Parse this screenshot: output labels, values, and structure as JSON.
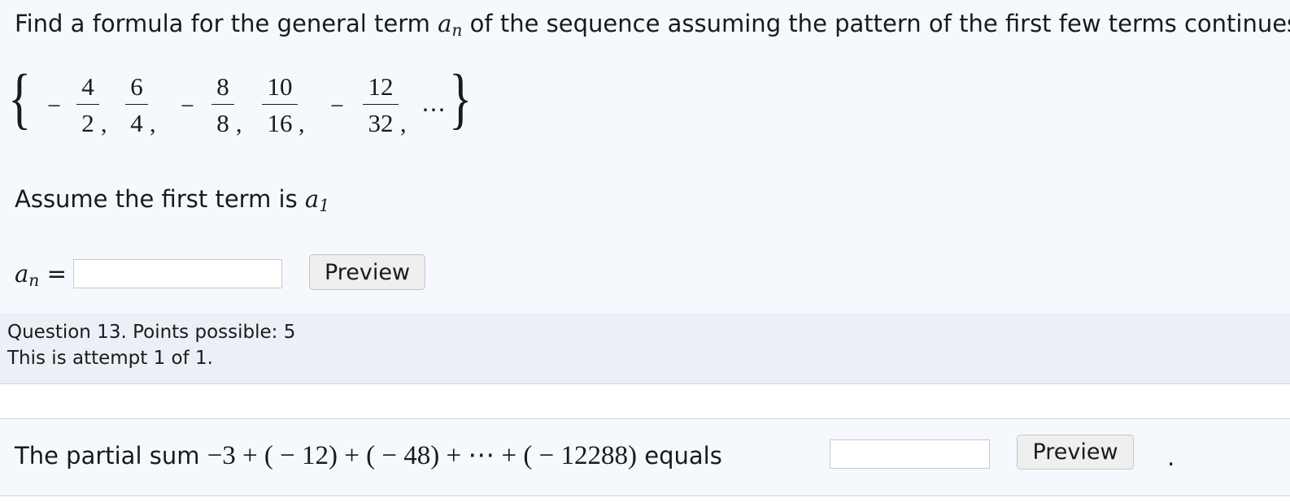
{
  "question1": {
    "prompt_before": "Find a formula for the general term ",
    "prompt_var": "a",
    "prompt_var_sub": "n",
    "prompt_after": " of the sequence assuming the pattern of the first few terms continues.",
    "sequence": {
      "open_brace": "{",
      "close_brace": "}",
      "minus": "−",
      "comma": ",",
      "ellipsis": "⋯",
      "terms": [
        {
          "sign": "−",
          "num": "4",
          "den": "2"
        },
        {
          "sign": "",
          "num": "6",
          "den": "4"
        },
        {
          "sign": "−",
          "num": "8",
          "den": "8"
        },
        {
          "sign": "",
          "num": "10",
          "den": "16"
        },
        {
          "sign": "−",
          "num": "12",
          "den": "32"
        }
      ]
    },
    "assume_text": "Assume the first term is ",
    "assume_var": "a",
    "assume_var_sub": "1",
    "answer_label_var": "a",
    "answer_label_sub": "n",
    "answer_label_eq": " =",
    "answer_value": "",
    "preview_label": "Preview"
  },
  "question_info": {
    "line1": "Question 13. Points possible: 5",
    "line2": "This is attempt 1 of 1."
  },
  "question2": {
    "text_before": "The partial sum ",
    "expression": "−3 + ( − 12) + ( − 48) + ⋯ + ( − 12288)",
    "text_after": " equals",
    "answer_value": "",
    "preview_label": "Preview",
    "trailing": "."
  }
}
